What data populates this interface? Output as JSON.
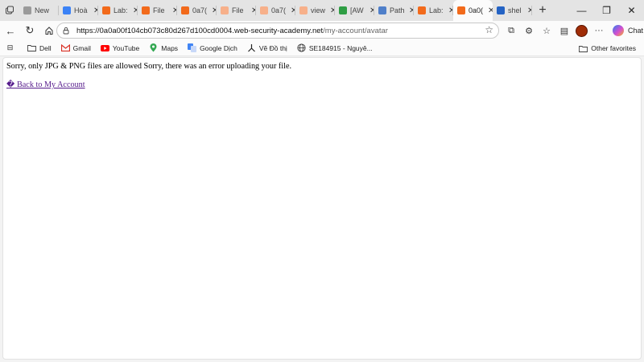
{
  "tabs": [
    {
      "title": "New",
      "fav_color": "#9a9a9a",
      "icon": "new-tab-icon",
      "has_close": false
    },
    {
      "title": "Hoà",
      "fav_color": "#3b82f6",
      "icon": "gemini-star-icon",
      "has_close": true
    },
    {
      "title": "Lab:",
      "fav_color": "#f26a1b",
      "icon": "portswigger-icon",
      "has_close": true
    },
    {
      "title": "File",
      "fav_color": "#f26a1b",
      "icon": "portswigger-icon",
      "has_close": true
    },
    {
      "title": "0a7(",
      "fav_color": "#f26a1b",
      "icon": "portswigger-icon",
      "has_close": true
    },
    {
      "title": "File",
      "fav_color": "#f7b08a",
      "icon": "portswigger-icon",
      "has_close": true
    },
    {
      "title": "0a7(",
      "fav_color": "#f7b08a",
      "icon": "portswigger-icon",
      "has_close": true
    },
    {
      "title": "view",
      "fav_color": "#f7b08a",
      "icon": "portswigger-icon",
      "has_close": true
    },
    {
      "title": "[AW",
      "fav_color": "#2f9e44",
      "icon": "drive-icon",
      "has_close": true
    },
    {
      "title": "Path",
      "fav_color": "#4f7fc9",
      "icon": "copilot-icon",
      "has_close": true
    },
    {
      "title": "Lab:",
      "fav_color": "#f26a1b",
      "icon": "portswigger-icon",
      "has_close": true
    },
    {
      "title": "0a0(",
      "fav_color": "#f26a1b",
      "icon": "portswigger-icon",
      "has_close": true,
      "active": true
    },
    {
      "title": "shel",
      "fav_color": "#2463c4",
      "icon": "search-icon",
      "has_close": true
    }
  ],
  "address_bar": {
    "url_host": "https://0a0a00f104cb073c80d267d100cd0004.web-security-academy.net",
    "url_path": "/my-account/avatar"
  },
  "toolbar": {
    "chat_label": "Chat"
  },
  "bookmarks": [
    {
      "label": "Dell",
      "icon": "folder-icon"
    },
    {
      "label": "Gmail",
      "icon": "gmail-icon"
    },
    {
      "label": "YouTube",
      "icon": "youtube-icon"
    },
    {
      "label": "Maps",
      "icon": "maps-pin-icon"
    },
    {
      "label": "Google Dịch",
      "icon": "google-translate-icon"
    },
    {
      "label": "Vẽ Đồ thị",
      "icon": "graph-icon"
    },
    {
      "label": "SE184915 - Nguyê...",
      "icon": "globe-icon"
    }
  ],
  "other_favorites": "Other favorites",
  "page": {
    "message": "Sorry, only JPG & PNG files are allowed Sorry, there was an error uploading your file.",
    "back_link": "� Back to My Account"
  },
  "colors": {
    "tabstrip_bg": "#e4e4e4",
    "toolbar_bg": "#fbfbfb",
    "link_visited": "#551a8b",
    "portswigger_orange": "#f26a1b"
  }
}
